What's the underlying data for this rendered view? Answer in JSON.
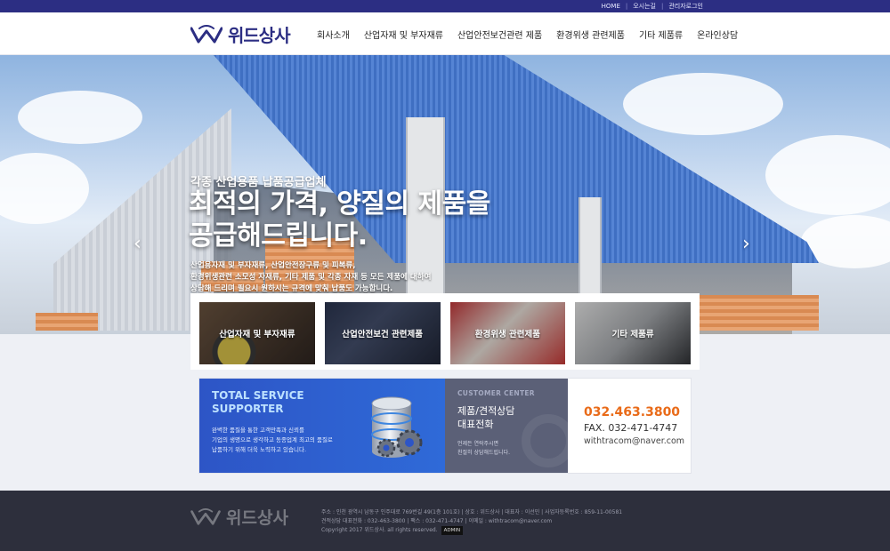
{
  "top_links": [
    "HOME",
    "오시는길",
    "관리자로그인"
  ],
  "brand": {
    "name": "위드상사",
    "color": "#2c2e83"
  },
  "nav": [
    "회사소개",
    "산업자재 및 부자재류",
    "산업안전보건관련 제품",
    "환경위생 관련제품",
    "기타 제품류",
    "온라인상담"
  ],
  "hero": {
    "subtitle": "각종 산업용품 납품공급업체",
    "title_line1": "최적의 가격, 양질의 제품을",
    "title_line2": "공급해드립니다.",
    "desc_line1": "산업용자재 및 부자재류, 산업안전장구류 및 피복류,",
    "desc_line2": "환경위생관련 소모성 자재류, 기타 제품 및 각종 자재 등 모든 제품에 대하여",
    "desc_line3": "상담해 드리며 필요시 원하시는 규격에 맞춰 납품도 가능합니다.",
    "prev_icon": "‹",
    "next_icon": "›"
  },
  "categories": [
    "산업자재 및 부자재류",
    "산업안전보건 관련제품",
    "환경위생 관련제품",
    "기타 제품류"
  ],
  "service": {
    "title_line1": "TOTAL SERVICE",
    "title_line2": "SUPPORTER",
    "desc_line1": "완벽한 품질을 통한 고객만족과 신뢰를",
    "desc_line2": "기업의 생명으로 생각하고 동종업계 최고의 품질로",
    "desc_line3": "납품하기 위해 더욱 노력하고 있습니다."
  },
  "customer_center": {
    "label": "CUSTOMER CENTER",
    "title_line1": "제품/견적상담",
    "title_line2": "대표전화",
    "desc_line1": "언제든 연락주시면",
    "desc_line2": "친절히 상담해드립니다."
  },
  "contact": {
    "phone": "032.463.3800",
    "fax": "FAX. 032-471-4747",
    "email": "withtracom@naver.com",
    "accent_color": "#e96b19"
  },
  "footer": {
    "logo": "위드상사",
    "line1": "주소 : 인천 광역시 남동구 인주대로 769번길 49(1층 101호)  |  상호 : 위드상사  |  대표자 : 이선민  |  사업자등록번호 : 859-11-00581",
    "line2": "견적상담 대표전화 : 032-463-3800  |  팩스 : 032-471-4747  |  이메일 : withtracom@naver.com",
    "line3": "Copyright 2017 위드상사. all rights reserved.",
    "admin": "ADMIN"
  }
}
